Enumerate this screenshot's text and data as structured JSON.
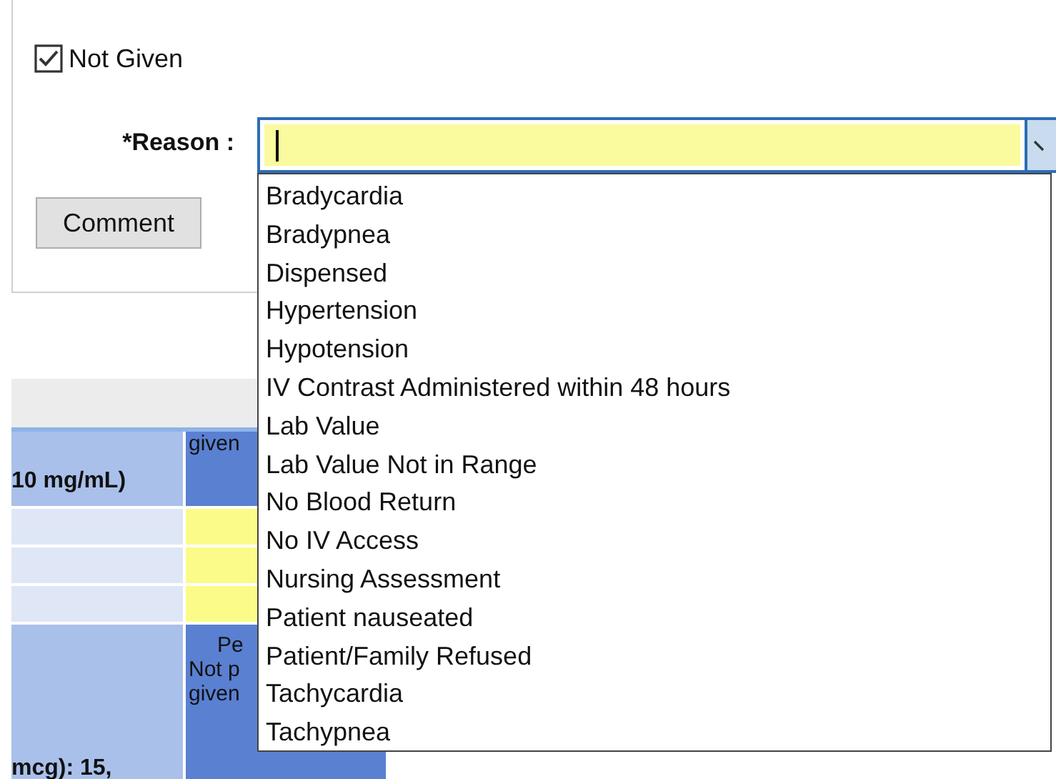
{
  "not_given": {
    "label": "Not Given",
    "checked": true
  },
  "reason": {
    "label": "*Reason :",
    "options": [
      {
        "label": "Bradycardia"
      },
      {
        "label": "Bradypnea"
      },
      {
        "label": "Dispensed"
      },
      {
        "label": "Hypertension"
      },
      {
        "label": "Hypotension"
      },
      {
        "label": "IV Contrast Administered within 48 hours"
      },
      {
        "label": "Lab Value"
      },
      {
        "label": "Lab Value Not in Range"
      },
      {
        "label": "No Blood Return"
      },
      {
        "label": "No IV Access"
      },
      {
        "label": "Nursing Assessment"
      },
      {
        "label": "Patient nauseated"
      },
      {
        "label": "Patient/Family Refused"
      },
      {
        "label": "Tachycardia"
      },
      {
        "label": "Tachypnea"
      }
    ]
  },
  "comment_button": "Comment",
  "table": {
    "rows": [
      {
        "kind": "header",
        "column_1": "10 mg/mL)",
        "column_2": [
          "given"
        ]
      },
      {
        "kind": "blank"
      },
      {
        "kind": "blank"
      },
      {
        "kind": "blank"
      },
      {
        "kind": "text",
        "column_1": "mcg): 15,",
        "column_2": [
          "Pe",
          "Not p",
          "given"
        ]
      }
    ]
  }
}
